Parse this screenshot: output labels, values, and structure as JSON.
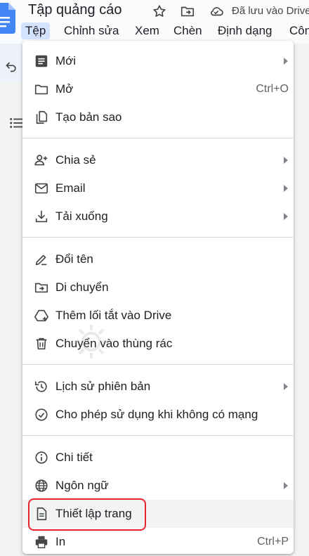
{
  "document": {
    "title": "Tập quảng cáo",
    "save_status": "Đã lưu vào Drive"
  },
  "menubar": [
    "Tệp",
    "Chỉnh sửa",
    "Xem",
    "Chèn",
    "Định dạng",
    "Côn"
  ],
  "file_menu": {
    "groups": [
      [
        {
          "label": "Mới",
          "icon": "new-doc-icon",
          "submenu": true
        },
        {
          "label": "Mở",
          "icon": "folder-icon",
          "shortcut": "Ctrl+O"
        },
        {
          "label": "Tạo bản sao",
          "icon": "copy-icon"
        }
      ],
      [
        {
          "label": "Chia sẻ",
          "icon": "person-add-icon",
          "submenu": true
        },
        {
          "label": "Email",
          "icon": "email-icon",
          "submenu": true
        },
        {
          "label": "Tải xuống",
          "icon": "download-icon",
          "submenu": true
        }
      ],
      [
        {
          "label": "Đổi tên",
          "icon": "rename-icon"
        },
        {
          "label": "Di chuyển",
          "icon": "move-folder-icon"
        },
        {
          "label": "Thêm lối tắt vào Drive",
          "icon": "drive-shortcut-icon"
        },
        {
          "label": "Chuyển vào thùng rác",
          "icon": "trash-icon"
        }
      ],
      [
        {
          "label": "Lịch sử phiên bản",
          "icon": "history-icon",
          "submenu": true
        },
        {
          "label": "Cho phép sử dụng khi không có mạng",
          "icon": "offline-check-icon"
        }
      ],
      [
        {
          "label": "Chi tiết",
          "icon": "info-icon"
        },
        {
          "label": "Ngôn ngữ",
          "icon": "globe-icon",
          "submenu": true
        },
        {
          "label": "Thiết lập trang",
          "icon": "page-setup-icon",
          "highlighted": true
        },
        {
          "label": "In",
          "icon": "print-icon",
          "shortcut": "Ctrl+P"
        }
      ]
    ]
  },
  "colors": {
    "accent": "#d3e3fd",
    "callout": "#e8242a",
    "docs_blue": "#4285f4"
  }
}
